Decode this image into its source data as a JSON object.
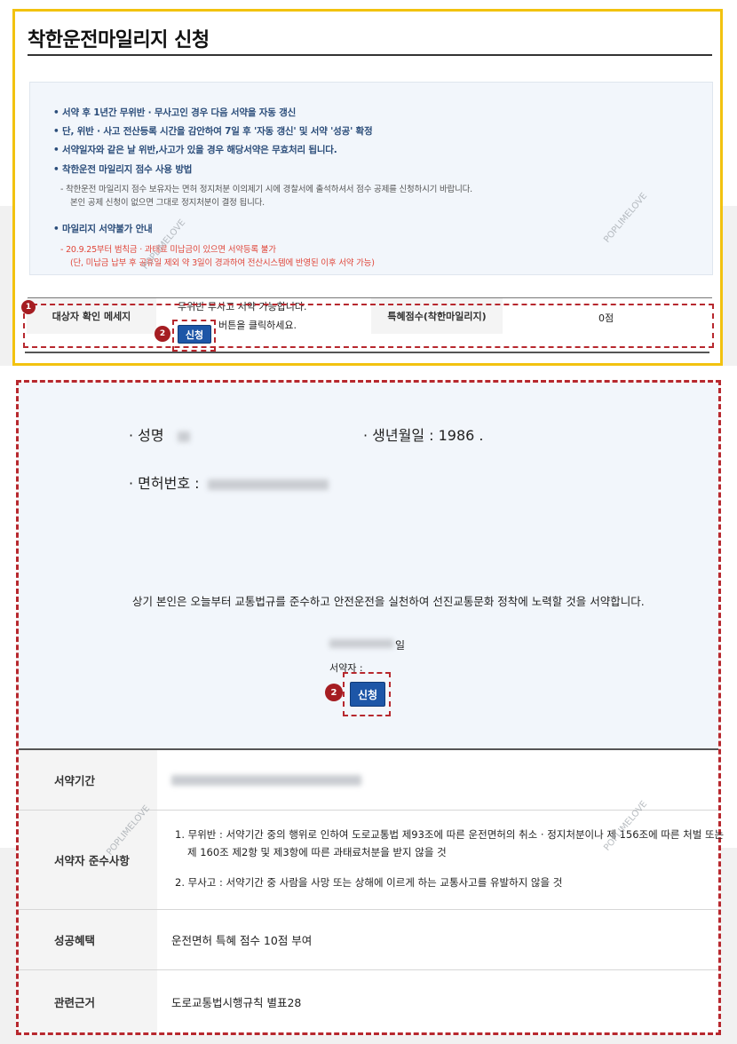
{
  "page": {
    "title": "착한운전마일리지 신청"
  },
  "notice": {
    "items": [
      "서약 후 1년간 무위반 · 무사고인 경우 다음 서약을 자동 갱신",
      "단, 위반 · 사고 전산등록 시간을 감안하여 7일 후 '자동 갱신' 및 서약 '성공' 확정",
      "서약일자와 같은 날 위반,사고가 있을 경우 해당서약은 무효처리 됩니다.",
      "착한운전 마일리지 점수 사용 방법"
    ],
    "usage_desc_1": "착한운전 마일리지 점수 보유자는 면허 정지처분 이의제기 시에 경찰서에 출석하셔서 점수 공제를 신청하시기 바랍니다.",
    "usage_desc_2": "본인 공제 신청이 없으면 그대로 정지처분이 결정 됩니다.",
    "unavailable_title": "마일리지 서약불가 안내",
    "unavailable_desc_1": "20.9.25부터 범칙금 · 과태료 미납금이 있으면 서약등록 불가",
    "unavailable_desc_2": "(단, 미납금 납부 후 공휴일 제외 약 3일이 경과하여 전산시스템에 반영된 이후 서약 가능)"
  },
  "target": {
    "label": "대상자 확인 메세지",
    "message_line1": "무위반 무사고 서약 가능합니다.",
    "message_line2": "버튼을 클릭하세요.",
    "apply_button": "신청",
    "benefit_label": "특혜점수(착한마일리지)",
    "benefit_value": "0점"
  },
  "badges": {
    "one": "1",
    "two": "2"
  },
  "applicant": {
    "name_label": "· 성명",
    "birth_label": "· 생년월일 : 1986 .",
    "license_label": "· 면허번호 :",
    "pledge_text": "상기 본인은 오늘부터 교통법규를 준수하고 안전운전을 실천하여 선진교통문화 정착에 노력할 것을 서약합니다.",
    "date_suffix": "일",
    "pledger_label": "서약자 :",
    "apply_button": "신청"
  },
  "info_table": {
    "period_label": "서약기간",
    "rules_label": "서약자 준수사항",
    "rule_1a": "1.  무위반 : 서약기간 중의 행위로 인하여 도로교통법 제93조에 따른 운전면허의 취소 · 정지처분이나 제 156조에 따른 처벌 또는",
    "rule_1b": "제 160조 제2항 및 제3항에 따른 과태료처분을 받지 않을 것",
    "rule_2": "2.  무사고 : 서약기간 중 사람을 사망 또는 상해에 이르게 하는 교통사고를 유발하지 않을 것",
    "benefit_label": "성공혜택",
    "benefit_value": "운전면허 특혜 점수 10점 부여",
    "basis_label": "관련근거",
    "basis_value": "도로교통법시행규칙 별표28"
  },
  "watermark": "POPLIMELOVE",
  "colors": {
    "accent_yellow": "#f2c20f",
    "highlight_red": "#b7282e",
    "button_blue": "#1d56a7",
    "notice_blue": "#2b4d7a",
    "warning_red": "#e0463a"
  }
}
